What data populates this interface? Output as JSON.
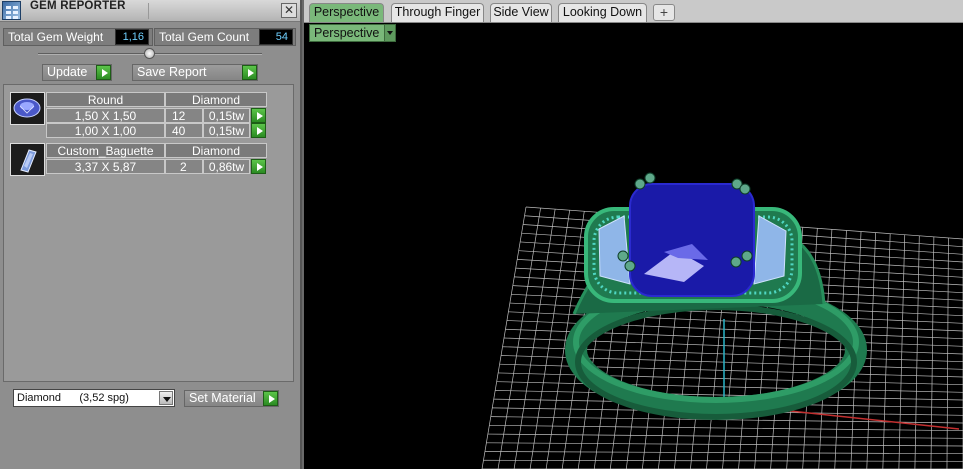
{
  "panel": {
    "title": "GEM REPORTER",
    "close_glyph": "✕",
    "total_weight_label": "Total Gem Weight",
    "total_weight_value": "1,16",
    "total_count_label": "Total Gem Count",
    "total_count_value": "54",
    "update_label": "Update",
    "save_report_label": "Save Report"
  },
  "gems": [
    {
      "icon": "round-gem-icon",
      "shape": "Round",
      "material": "Diamond",
      "rows": [
        {
          "size": "1,50 X 1,50",
          "count": "12",
          "weight": "0,15tw"
        },
        {
          "size": "1,00 X 1,00",
          "count": "40",
          "weight": "0,15tw"
        }
      ]
    },
    {
      "icon": "baguette-gem-icon",
      "shape": "Custom_Baguette",
      "material": "Diamond",
      "rows": [
        {
          "size": "3,37 X 5,87",
          "count": "2",
          "weight": "0,86tw"
        }
      ]
    }
  ],
  "material_select": {
    "value": "Diamond      (3,52 spg)"
  },
  "set_material_label": "Set Material",
  "tabs": [
    {
      "label": "Perspective",
      "active": true
    },
    {
      "label": "Through Finger",
      "active": false
    },
    {
      "label": "Side View",
      "active": false
    },
    {
      "label": "Looking Down",
      "active": false
    }
  ],
  "add_tab_glyph": "+",
  "view_select": {
    "value": "Perspective"
  },
  "colors": {
    "active_tab": "#7ab87a",
    "go_button": "#3aa52e",
    "stat_value_text": "#6fd0ff",
    "ring_metal": "#1f7a4f",
    "center_stone": "#1a1aa8",
    "side_stones": "#8fb6e8",
    "grid": "#bdbdbd"
  }
}
